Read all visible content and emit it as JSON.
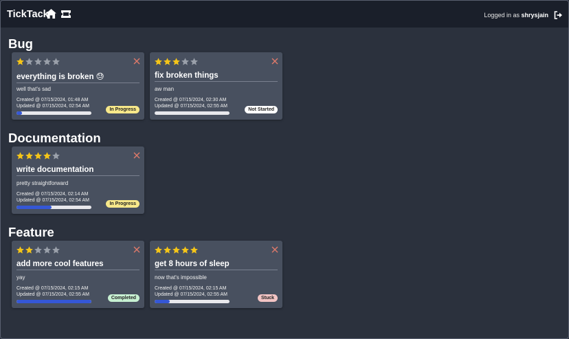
{
  "app": {
    "brand": "TickTack",
    "login_prefix": "Logged in as ",
    "username": "shrysjain"
  },
  "colors": {
    "star_on": "#f5c518",
    "star_off": "#9aa0aa",
    "close": "#e07a6a",
    "progress": "#3557d6",
    "badge_in_progress": "#f7e88a",
    "badge_not_started": "#ffffff",
    "badge_completed": "#c7f0d2",
    "badge_stuck": "#f2c4c4"
  },
  "sections": [
    {
      "title": "Bug",
      "cards": [
        {
          "rating": 1,
          "title": "everything is broken 😓",
          "description": "well that's sad",
          "created": "Created @ 07/15/2024, 01:48 AM",
          "updated": "Updated @ 07/15/2024, 02:54 AM",
          "progress": 0.07,
          "status": "In Progress",
          "status_key": "in_progress"
        },
        {
          "rating": 3,
          "title": "fix broken things",
          "description": "aw man",
          "created": "Created @ 07/15/2024, 02:30 AM",
          "updated": "Updated @ 07/15/2024, 02:55 AM",
          "progress": 0.0,
          "status": "Not Started",
          "status_key": "not_started"
        }
      ]
    },
    {
      "title": "Documentation",
      "cards": [
        {
          "rating": 4,
          "title": "write documentation",
          "description": "pretty straightforward",
          "created": "Created @ 07/15/2024, 02:14 AM",
          "updated": "Updated @ 07/15/2024, 02:54 AM",
          "progress": 0.47,
          "status": "In Progress",
          "status_key": "in_progress"
        }
      ]
    },
    {
      "title": "Feature",
      "cards": [
        {
          "rating": 2,
          "title": "add more cool features",
          "description": "yay",
          "created": "Created @ 07/15/2024, 02:15 AM",
          "updated": "Updated @ 07/15/2024, 02:55 AM",
          "progress": 1.0,
          "status": "Completed",
          "status_key": "completed"
        },
        {
          "rating": 5,
          "title": "get 8 hours of sleep",
          "description": "now that's impossible",
          "created": "Created @ 07/15/2024, 02:15 AM",
          "updated": "Updated @ 07/15/2024, 02:55 AM",
          "progress": 0.2,
          "status": "Stuck",
          "status_key": "stuck"
        }
      ]
    }
  ]
}
